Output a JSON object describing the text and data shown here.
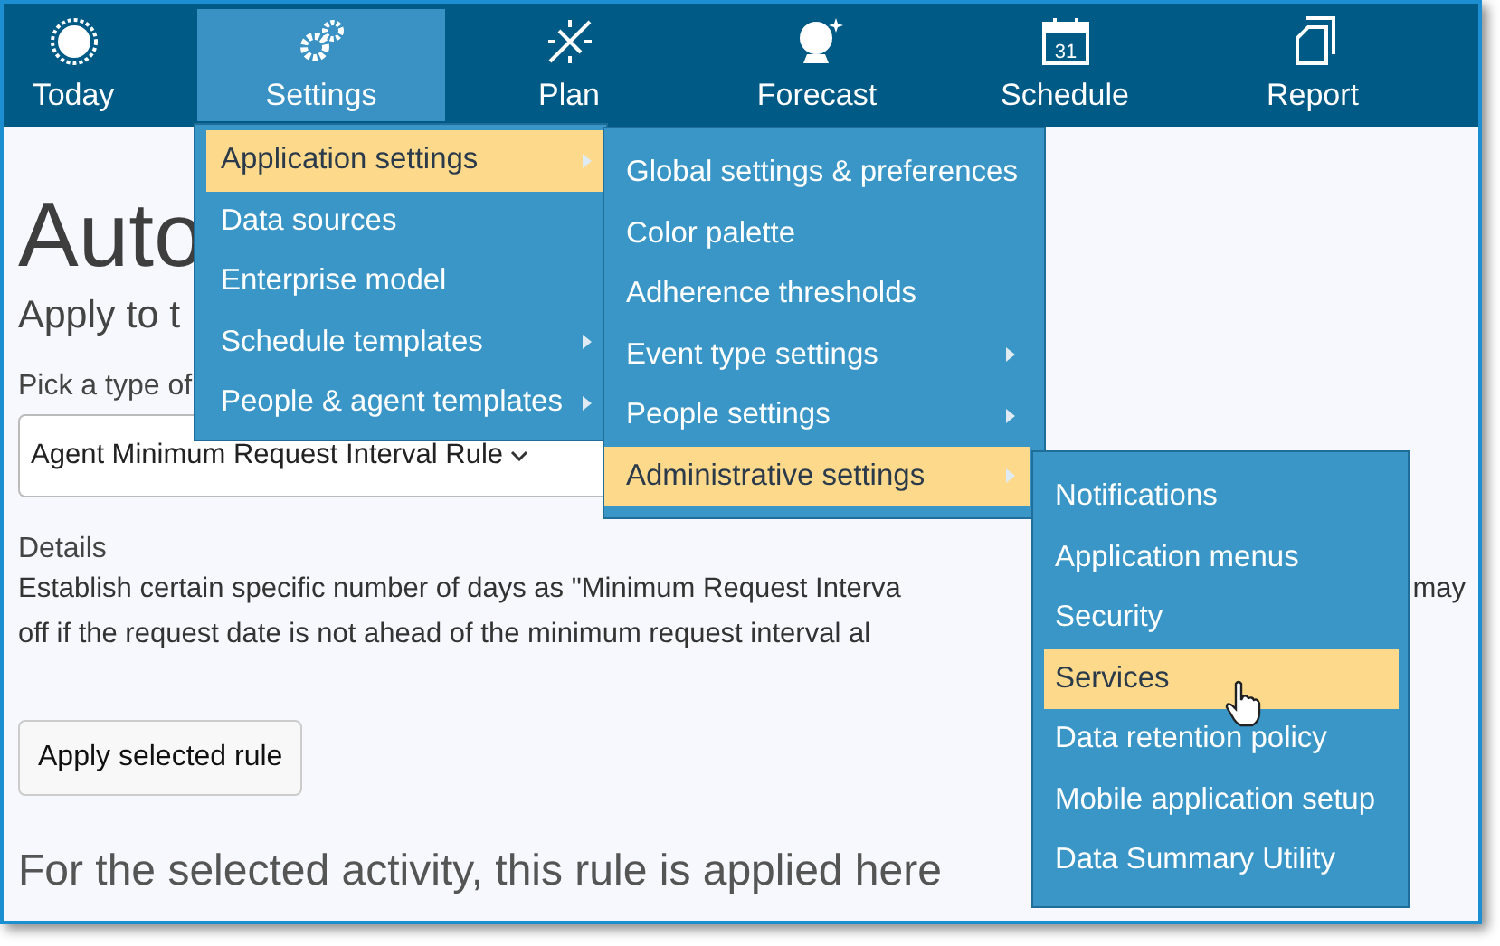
{
  "nav": [
    {
      "label": "Today",
      "selected": false
    },
    {
      "label": "Settings",
      "selected": true
    },
    {
      "label": "Plan",
      "selected": false
    },
    {
      "label": "Forecast",
      "selected": false
    },
    {
      "label": "Schedule",
      "calendar_day": "31",
      "selected": false
    },
    {
      "label": "Report",
      "selected": false
    }
  ],
  "page": {
    "title": "Auto",
    "subtitle": "Apply to t",
    "pick_label": "Pick a type of",
    "rule_select": {
      "value": "Agent Minimum Request Interval Rule"
    },
    "details_label": "Details",
    "details_lines": [
      [
        "Establish certain specific number of days as \"Minimum Request Interva",
        "may"
      ],
      [
        "off if the request date is not ahead of the minimum request interval al"
      ]
    ],
    "apply_button": "Apply selected rule",
    "applied_heading": "For the selected activity, this rule is applied here"
  },
  "settings_menu": [
    {
      "label": "Application settings",
      "submenu": true,
      "selected": true
    },
    {
      "label": "Data sources",
      "submenu": false,
      "selected": false
    },
    {
      "label": "Enterprise model",
      "submenu": false,
      "selected": false
    },
    {
      "label": "Schedule templates",
      "submenu": true,
      "selected": false
    },
    {
      "label": "People & agent templates",
      "submenu": true,
      "selected": false
    }
  ],
  "application_settings_menu": [
    {
      "label": "Global settings & preferences",
      "submenu": false,
      "selected": false
    },
    {
      "label": "Color palette",
      "submenu": false,
      "selected": false
    },
    {
      "label": "Adherence thresholds",
      "submenu": false,
      "selected": false
    },
    {
      "label": "Event type settings",
      "submenu": true,
      "selected": false
    },
    {
      "label": "People settings",
      "submenu": true,
      "selected": false
    },
    {
      "label": "Administrative settings",
      "submenu": true,
      "selected": true
    }
  ],
  "administrative_settings_menu": [
    {
      "label": "Notifications",
      "submenu": false,
      "selected": false
    },
    {
      "label": "Application menus",
      "submenu": false,
      "selected": false
    },
    {
      "label": "Security",
      "submenu": false,
      "selected": false
    },
    {
      "label": "Services",
      "submenu": false,
      "selected": true
    },
    {
      "label": "Data retention policy",
      "submenu": false,
      "selected": false
    },
    {
      "label": "Mobile application setup",
      "submenu": false,
      "selected": false
    },
    {
      "label": "Data Summary Utility",
      "submenu": false,
      "selected": false
    }
  ]
}
